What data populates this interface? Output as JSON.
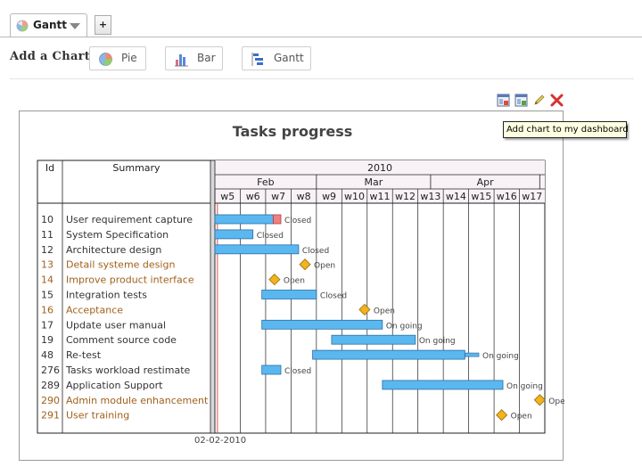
{
  "tabs": {
    "active_label": "Gantt",
    "add_label": "+"
  },
  "add_chart": {
    "label": "Add a Chart",
    "buttons": [
      {
        "label": "Pie"
      },
      {
        "label": "Bar"
      },
      {
        "label": "Gantt"
      }
    ]
  },
  "toolbar": {
    "tooltip": "Add chart to my dashboard"
  },
  "colors": {
    "bar_fill": "#5bb7ef",
    "bar_stroke": "#2a6ea6",
    "milestone": "#f2b31b",
    "late": "#f08080",
    "orange_text": "#a0611b"
  },
  "chart_data": {
    "type": "gantt",
    "title": "Tasks progress",
    "table_headers": {
      "id": "Id",
      "summary": "Summary"
    },
    "year": "2010",
    "months": [
      "Feb",
      "Mar",
      "Apr"
    ],
    "weeks": [
      "w5",
      "w6",
      "w7",
      "w8",
      "w9",
      "w10",
      "w11",
      "w12",
      "w13",
      "w14",
      "w15",
      "w16",
      "w17"
    ],
    "footer_date": "02-02-2010",
    "rows": [
      {
        "id": "10",
        "summary": "User requirement capture",
        "highlight": false,
        "kind": "bar",
        "start": 5.0,
        "end": 7.3,
        "late_start": 7.3,
        "late_end": 7.6,
        "status": "Closed"
      },
      {
        "id": "11",
        "summary": "System Specification",
        "highlight": false,
        "kind": "bar",
        "start": 5.0,
        "end": 6.5,
        "status": "Closed"
      },
      {
        "id": "12",
        "summary": "Architecture design",
        "highlight": false,
        "kind": "bar",
        "start": 5.0,
        "end": 8.3,
        "status": "Closed"
      },
      {
        "id": "13",
        "summary": "Detail systeme design",
        "highlight": true,
        "kind": "milestone",
        "at": 8.55,
        "status": "Open"
      },
      {
        "id": "14",
        "summary": "Improve product interface",
        "highlight": true,
        "kind": "milestone",
        "at": 7.35,
        "status": "Open"
      },
      {
        "id": "15",
        "summary": "Integration tests",
        "highlight": false,
        "kind": "bar",
        "start": 6.85,
        "end": 9.0,
        "status": "Closed"
      },
      {
        "id": "16",
        "summary": "Acceptance",
        "highlight": true,
        "kind": "milestone",
        "at": 10.9,
        "status": "Open"
      },
      {
        "id": "17",
        "summary": "Update user manual",
        "highlight": false,
        "kind": "bar",
        "start": 6.85,
        "end": 11.6,
        "status": "On going"
      },
      {
        "id": "19",
        "summary": "Comment source code",
        "highlight": false,
        "kind": "bar",
        "start": 9.6,
        "end": 12.9,
        "status": "On going"
      },
      {
        "id": "48",
        "summary": "Re-test",
        "highlight": false,
        "kind": "bar",
        "start": 8.85,
        "end": 14.85,
        "ext_end": 15.4,
        "status": "On going"
      },
      {
        "id": "276",
        "summary": "Tasks workload restimate",
        "highlight": false,
        "kind": "bar",
        "start": 6.85,
        "end": 7.6,
        "status": "Closed"
      },
      {
        "id": "289",
        "summary": "Application Support",
        "highlight": false,
        "kind": "bar",
        "start": 11.6,
        "end": 16.35,
        "status": "On going"
      },
      {
        "id": "290",
        "summary": "Admin module enhancement",
        "highlight": true,
        "kind": "milestone",
        "at": 17.8,
        "status": "Open"
      },
      {
        "id": "291",
        "summary": "User training",
        "highlight": true,
        "kind": "milestone",
        "at": 16.3,
        "status": "Open"
      }
    ]
  }
}
